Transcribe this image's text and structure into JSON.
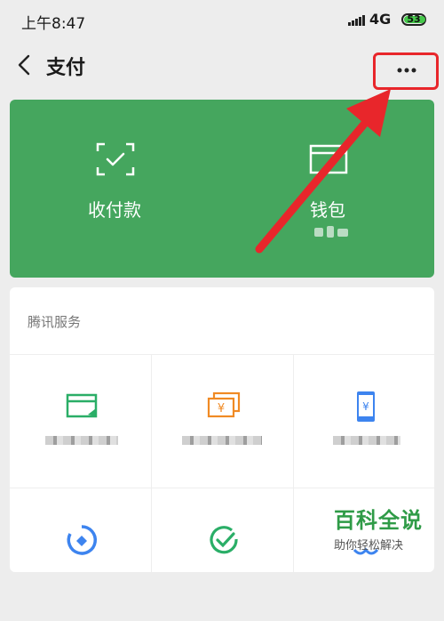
{
  "status": {
    "time": "上午8:47",
    "network": "4G",
    "battery": "53"
  },
  "nav": {
    "title": "支付"
  },
  "green_panel": {
    "color": "#45a65e",
    "items": [
      {
        "label": "收付款",
        "icon": "scan-qr-check-icon"
      },
      {
        "label": "钱包",
        "icon": "wallet-icon"
      }
    ]
  },
  "services": {
    "title": "腾讯服务",
    "items": [
      {
        "icon": "card-repay-icon",
        "color": "#2aae67"
      },
      {
        "icon": "cash-transfer-icon",
        "color": "#f08a24"
      },
      {
        "icon": "phone-topup-icon",
        "color": "#3d84ef"
      },
      {
        "icon": "wealth-management-icon",
        "color": "#3d84ef"
      },
      {
        "icon": "insurance-check-icon",
        "color": "#2aae67"
      },
      {
        "icon": "partial-blue-icon",
        "color": "#3d84ef"
      }
    ]
  },
  "annotation": {
    "color": "#e8262b"
  },
  "watermark": {
    "main": "百科全说",
    "sub": "助你轻松解决"
  }
}
